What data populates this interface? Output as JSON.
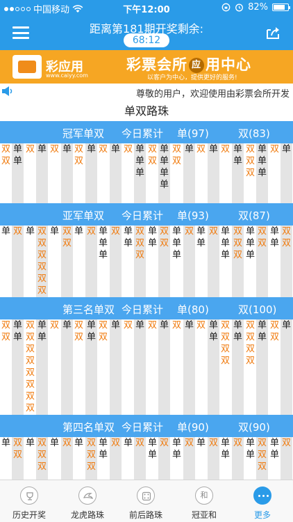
{
  "status_bar": {
    "carrier": "中国移动",
    "time": "下午12:00",
    "battery": "82%",
    "battery_level": 0.82
  },
  "nav": {
    "title": "距离第181期开奖剩余:",
    "countdown": "68:12"
  },
  "banner": {
    "brand": "彩应用",
    "brand_sub": "www.caiyy.com",
    "center_left": "彩票会所",
    "center_badge": "应",
    "center_right": "用中心",
    "tagline": "以客户为中心，提供更好的服务!"
  },
  "notice": "尊敬的用户，欢迎使用由彩票会所开发",
  "page_title": "单双路珠",
  "sections": [
    {
      "name": "冠军单双",
      "today": "今日累计",
      "dan": "单(97)",
      "shuang": "双(83)",
      "columns": [
        [
          "双",
          "双"
        ],
        [
          "单",
          "单"
        ],
        [
          "双"
        ],
        [
          "单"
        ],
        [
          "双"
        ],
        [
          "单"
        ],
        [
          "双",
          "双"
        ],
        [
          "单"
        ],
        [
          "双"
        ],
        [
          "单"
        ],
        [
          "双"
        ],
        [
          "单",
          "单",
          "单"
        ],
        [
          "双",
          "双"
        ],
        [
          "单",
          "单",
          "单",
          "单"
        ],
        [
          "双",
          "双"
        ],
        [
          "单"
        ],
        [
          "双"
        ],
        [
          "单"
        ],
        [
          "双"
        ],
        [
          "单",
          "单"
        ],
        [
          "双",
          "双",
          "双"
        ],
        [
          "单",
          "单",
          "单"
        ],
        [
          "双"
        ],
        [
          "单"
        ]
      ]
    },
    {
      "name": "亚军单双",
      "today": "今日累计",
      "dan": "单(93)",
      "shuang": "双(87)",
      "columns": [
        [
          "单"
        ],
        [
          "双"
        ],
        [
          "单"
        ],
        [
          "双",
          "双",
          "双",
          "双",
          "双",
          "双"
        ],
        [
          "单"
        ],
        [
          "双",
          "双"
        ],
        [
          "单"
        ],
        [
          "双"
        ],
        [
          "单",
          "单",
          "单"
        ],
        [
          "双"
        ],
        [
          "单",
          "单"
        ],
        [
          "双",
          "双",
          "双"
        ],
        [
          "单",
          "单"
        ],
        [
          "双",
          "双"
        ],
        [
          "单",
          "单",
          "单"
        ],
        [
          "双"
        ],
        [
          "单",
          "单"
        ],
        [
          "双"
        ],
        [
          "单",
          "单",
          "单"
        ],
        [
          "双",
          "双",
          "双"
        ],
        [
          "单",
          "单",
          "单"
        ],
        [
          "双",
          "双"
        ],
        [
          "单",
          "单"
        ],
        [
          "双",
          "双"
        ]
      ]
    },
    {
      "name": "第三名单双",
      "today": "今日累计",
      "dan": "单(80)",
      "shuang": "双(100)",
      "columns": [
        [
          "双",
          "双"
        ],
        [
          "单",
          "单"
        ],
        [
          "双",
          "双",
          "双",
          "双",
          "双",
          "双",
          "双",
          "双"
        ],
        [
          "单",
          "单"
        ],
        [
          "双"
        ],
        [
          "单"
        ],
        [
          "双",
          "双"
        ],
        [
          "单",
          "单"
        ],
        [
          "双",
          "双"
        ],
        [
          "单"
        ],
        [
          "双"
        ],
        [
          "单"
        ],
        [
          "双"
        ],
        [
          "单"
        ],
        [
          "双"
        ],
        [
          "单"
        ],
        [
          "双"
        ],
        [
          "单",
          "单"
        ],
        [
          "双",
          "双",
          "双",
          "双"
        ],
        [
          "单",
          "单"
        ],
        [
          "双",
          "双",
          "双",
          "双"
        ],
        [
          "单",
          "单"
        ],
        [
          "双",
          "双"
        ],
        [
          "单"
        ]
      ]
    },
    {
      "name": "第四名单双",
      "today": "今日累计",
      "dan": "单(90)",
      "shuang": "双(90)",
      "columns": [
        [
          "单"
        ],
        [
          "双",
          "双"
        ],
        [
          "单"
        ],
        [
          "双",
          "双",
          "双"
        ],
        [
          "单"
        ],
        [
          "双"
        ],
        [
          "单"
        ],
        [
          "双",
          "双",
          "双"
        ],
        [
          "单",
          "单"
        ],
        [
          "双"
        ],
        [
          "单"
        ],
        [
          "双"
        ],
        [
          "单",
          "单"
        ],
        [
          "双"
        ],
        [
          "单",
          "单"
        ],
        [
          "双"
        ],
        [
          "单"
        ],
        [
          "双"
        ],
        [
          "单",
          "单"
        ],
        [
          "双"
        ],
        [
          "单",
          "单"
        ],
        [
          "双",
          "双",
          "双"
        ],
        [
          "单",
          "单"
        ],
        [
          "双"
        ]
      ]
    }
  ],
  "tabs": [
    {
      "label": "历史开奖",
      "icon": "trophy-icon",
      "active": false
    },
    {
      "label": "龙虎路珠",
      "icon": "dragon-icon",
      "active": false
    },
    {
      "label": "前后路珠",
      "icon": "dice-icon",
      "active": false
    },
    {
      "label": "冠亚和",
      "icon": "he-icon",
      "icon_text": "和",
      "active": false
    },
    {
      "label": "更多",
      "icon": "more-icon",
      "active": true
    }
  ],
  "colors": {
    "primary": "#2a9be8",
    "section_header": "#4aa6ef",
    "banner": "#f6a623",
    "dan": "#222222",
    "shuang": "#f07c10",
    "stripe": "#e4e4e4"
  }
}
